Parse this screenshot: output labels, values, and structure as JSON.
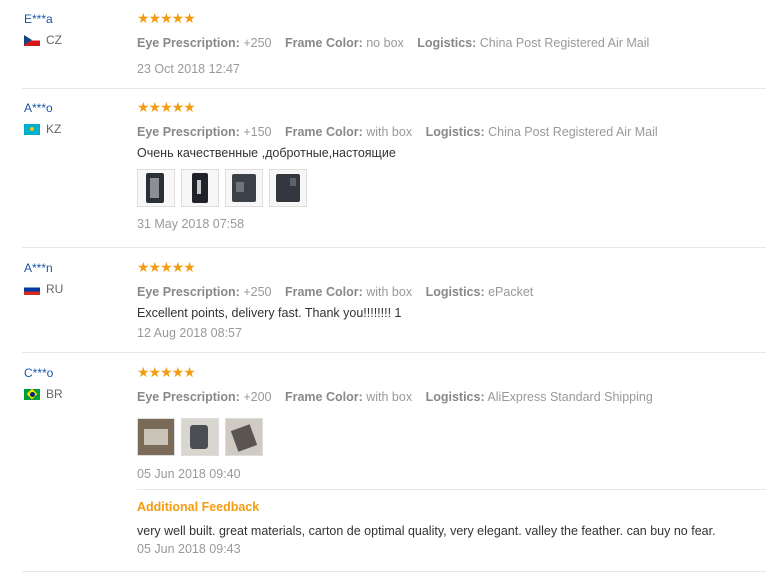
{
  "labels": {
    "eye_prescription": "Eye Prescription:",
    "frame_color": "Frame Color:",
    "logistics": "Logistics:"
  },
  "stars_glyph": "★★★★★",
  "reviews": [
    {
      "user": "E***a",
      "country": "CZ",
      "flag": "flag-cz",
      "rating": 5,
      "eye_prescription": "+250",
      "frame_color": "no box",
      "logistics": "China Post Registered Air Mail",
      "text": "",
      "photo_count": 0,
      "date": "23 Oct 2018 12:47"
    },
    {
      "user": "A***o",
      "country": "KZ",
      "flag": "flag-kz",
      "rating": 5,
      "eye_prescription": "+150",
      "frame_color": "with box",
      "logistics": "China Post Registered Air Mail",
      "text": "Очень качественные ,добротные,настоящие",
      "photo_count": 4,
      "date": "31 May 2018 07:58"
    },
    {
      "user": "A***n",
      "country": "RU",
      "flag": "flag-ru",
      "rating": 5,
      "eye_prescription": "+250",
      "frame_color": "with box",
      "logistics": "ePacket",
      "text": "Excellent points, delivery fast. Thank you!!!!!!!! 1",
      "photo_count": 0,
      "date": "12 Aug 2018 08:57"
    },
    {
      "user": "C***o",
      "country": "BR",
      "flag": "flag-br",
      "rating": 5,
      "eye_prescription": "+200",
      "frame_color": "with box",
      "logistics": "AliExpress Standard Shipping",
      "text": "",
      "photo_count": 3,
      "date": "05 Jun 2018 09:40",
      "additional_feedback": {
        "title": "Additional Feedback",
        "text": "very well built. great materials, carton de optimal quality, very elegant. valley the feather. can buy no fear.",
        "date": "05 Jun 2018 09:43"
      }
    }
  ],
  "colors": {
    "username": "#1a57a8",
    "stars": "#f39c12",
    "additional_feedback_title": "#f39c12",
    "muted": "#999999"
  }
}
